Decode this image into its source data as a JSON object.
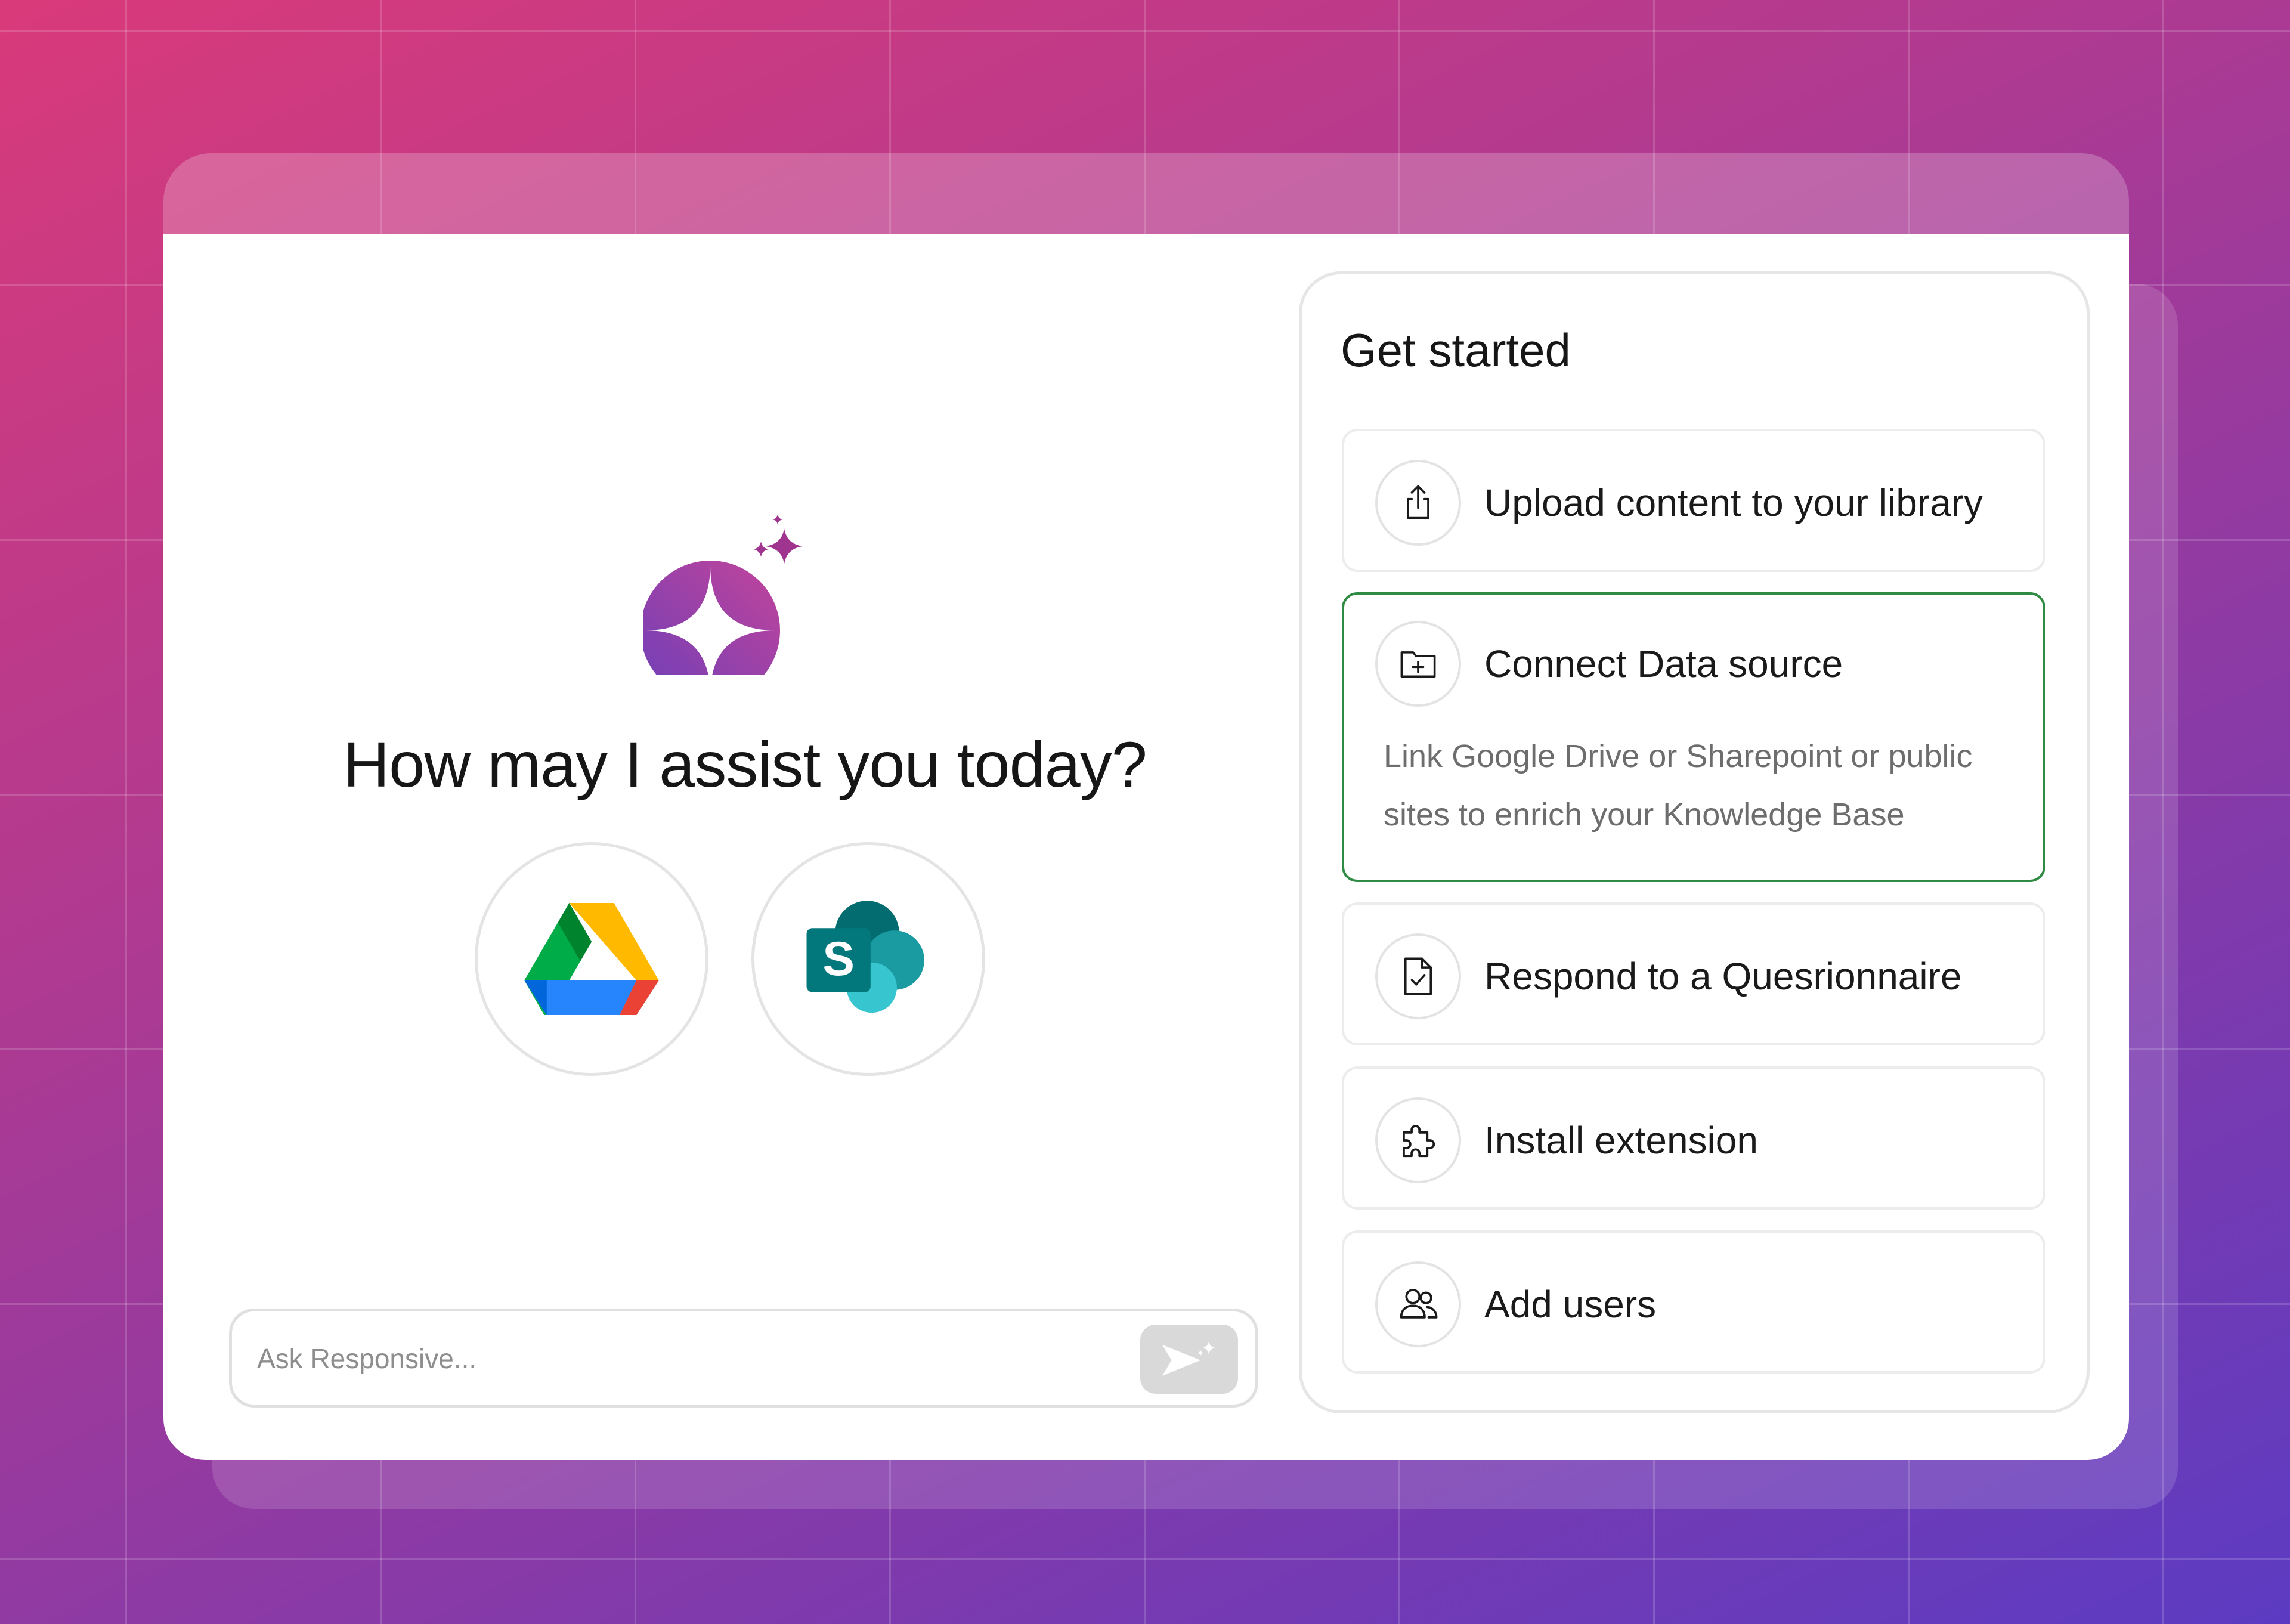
{
  "main": {
    "headline": "How may I assist you today?",
    "sources": [
      {
        "icon": "google-drive-icon"
      },
      {
        "icon": "sharepoint-icon",
        "letter": "S"
      }
    ],
    "chat": {
      "placeholder": "Ask Responsive...",
      "send_icon": "send-sparkle-icon"
    }
  },
  "panel": {
    "title": "Get started",
    "actions": [
      {
        "label": "Upload content to your library",
        "icon": "upload-icon"
      },
      {
        "label": "Connect Data source",
        "icon": "folder-plus-icon",
        "selected": true,
        "description": "Link Google Drive or Sharepoint or public sites to enrich your Knowledge Base"
      },
      {
        "label": "Respond to a Quesrionnaire",
        "icon": "document-check-icon"
      },
      {
        "label": "Install extension",
        "icon": "puzzle-icon"
      },
      {
        "label": "Add users",
        "icon": "users-icon"
      }
    ]
  },
  "colors": {
    "accent_selected_border": "#2f8a43",
    "brand_gradient_start": "#7b3fb5",
    "brand_gradient_end": "#c0449a",
    "background_start": "#d93a7a",
    "background_end": "#5c3bc2"
  }
}
